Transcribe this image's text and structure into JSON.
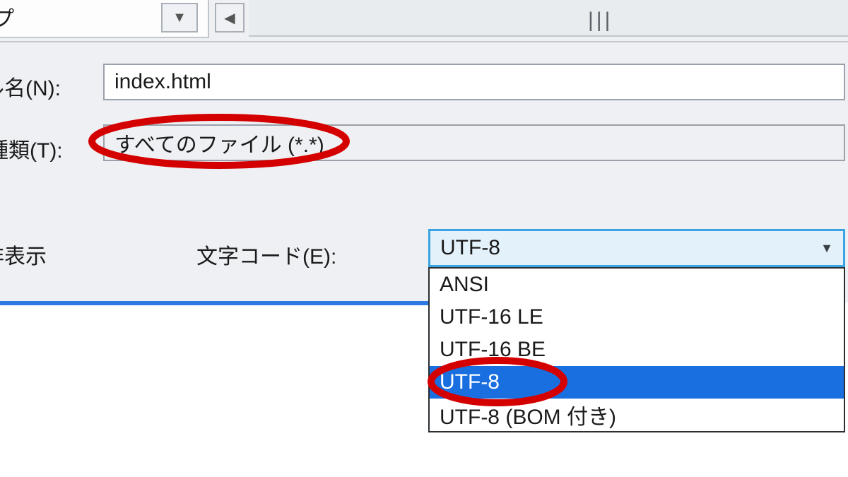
{
  "top": {
    "corner_text": "ップ"
  },
  "labels": {
    "filename": "ル名(N):",
    "filetype": "種類(T):",
    "hide_folders": "非表示",
    "encoding": "文字コード(E):"
  },
  "fields": {
    "filename_value": "index.html",
    "filetype_value": "すべてのファイル (*.*)"
  },
  "encoding": {
    "selected": "UTF-8",
    "options": [
      "ANSI",
      "UTF-16 LE",
      "UTF-16 BE",
      "UTF-8",
      "UTF-8 (BOM 付き)"
    ],
    "highlighted_index": 3
  },
  "annotation": {
    "circled_filetype": true,
    "circled_encoding_option": "UTF-8"
  }
}
